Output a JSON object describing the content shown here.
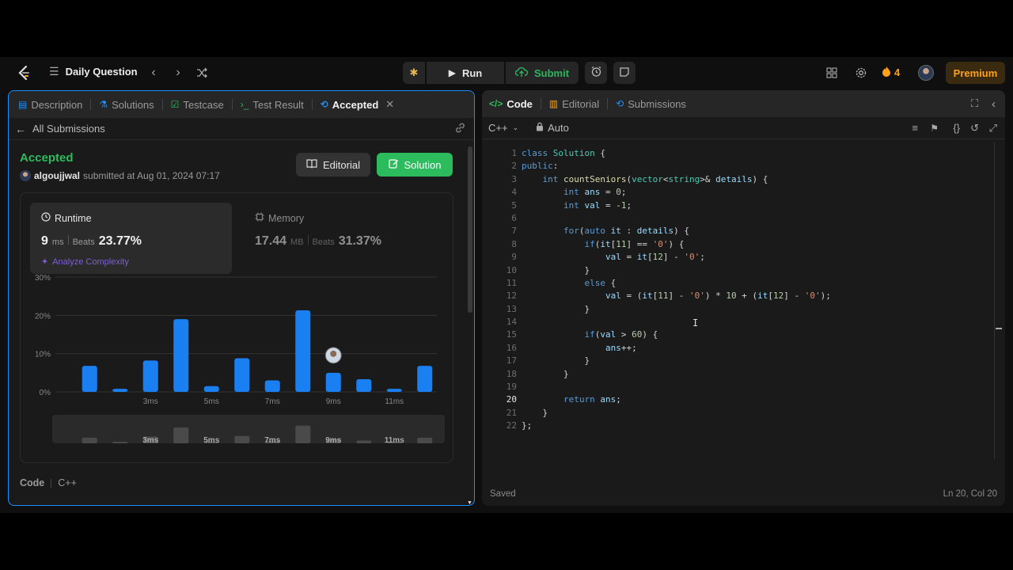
{
  "nav": {
    "title": "Daily Question",
    "run": "Run",
    "submit": "Submit",
    "streak": "4",
    "premium": "Premium"
  },
  "left_tabs": [
    {
      "label": "Description",
      "icon": "document-icon"
    },
    {
      "label": "Solutions",
      "icon": "flask-icon"
    },
    {
      "label": "Testcase",
      "icon": "check-square-icon"
    },
    {
      "label": "Test Result",
      "icon": "terminal-icon"
    },
    {
      "label": "Accepted",
      "icon": "history-icon"
    }
  ],
  "left_sub": {
    "back": "All Submissions"
  },
  "submission": {
    "status": "Accepted",
    "user": "algoujjwal",
    "submitted_text": "submitted at Aug 01, 2024 07:17",
    "editorial_btn": "Editorial",
    "solution_btn": "Solution"
  },
  "runtime": {
    "label": "Runtime",
    "value": "9",
    "unit": "ms",
    "beats_label": "Beats",
    "beats": "23.77%",
    "analyze": "Analyze Complexity"
  },
  "memory": {
    "label": "Memory",
    "value": "17.44",
    "unit": "MB",
    "beats_label": "Beats",
    "beats": "31.37%"
  },
  "chart_data": {
    "type": "bar",
    "yticks": [
      "30%",
      "20%",
      "10%",
      "0%"
    ],
    "ylim": [
      0,
      30
    ],
    "x_tick_labels": [
      "3ms",
      "5ms",
      "7ms",
      "9ms",
      "11ms"
    ],
    "values": [
      6.8,
      0.8,
      8.2,
      19,
      1.5,
      8.8,
      3,
      21.3,
      5,
      3.3,
      0.8,
      6.8
    ],
    "highlight_index": 8
  },
  "overview_labels": [
    "3ms",
    "5ms",
    "7ms",
    "9ms",
    "11ms"
  ],
  "code_label": {
    "title": "Code",
    "lang": "C++"
  },
  "right_tabs": [
    {
      "label": "Code",
      "icon": "code-icon"
    },
    {
      "label": "Editorial",
      "icon": "book-icon"
    },
    {
      "label": "Submissions",
      "icon": "history-icon"
    }
  ],
  "editor": {
    "language": "C++",
    "mode": "Auto",
    "saved": "Saved",
    "position": "Ln 20, Col 20",
    "current_line": 20,
    "lines": [
      "class Solution {",
      "public:",
      "    int countSeniors(vector<string>& details) {",
      "        int ans = 0;",
      "        int val = -1;",
      "",
      "        for(auto it : details) {",
      "            if(it[11] == '0') {",
      "                val = it[12] - '0';",
      "            }",
      "            else {",
      "                val = (it[11] - '0') * 10 + (it[12] - '0');",
      "            }",
      "",
      "            if(val > 60) {",
      "                ans++;",
      "            }",
      "        }",
      "",
      "        return ans;",
      "    }",
      "};"
    ]
  }
}
